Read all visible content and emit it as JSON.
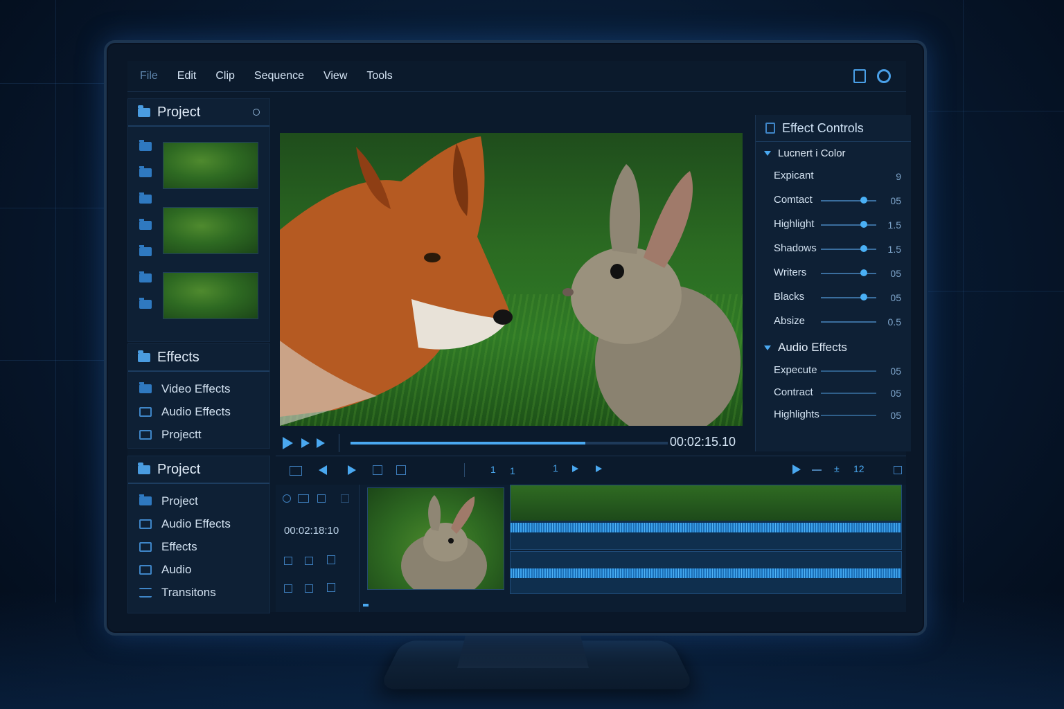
{
  "menu": {
    "items": [
      "File",
      "Edit",
      "Clip",
      "Sequence",
      "View",
      "Tools"
    ]
  },
  "project_panel": {
    "title": "Project"
  },
  "effects_panel": {
    "title": "Effects",
    "items": [
      "Video Effects",
      "Audio Effects",
      "Projectt"
    ]
  },
  "project_panel_2": {
    "title": "Project",
    "items": [
      "Project",
      "Audio Effects",
      "Effects",
      "Audio",
      "Transitons"
    ]
  },
  "viewer": {
    "timecode": "00:02:15.10",
    "progress": 0.74
  },
  "effect_controls": {
    "title": "Effect Controls",
    "color_section": "Lucnert i Color",
    "color_rows": [
      {
        "label": "Expicant",
        "value": "9",
        "level": null
      },
      {
        "label": "Comtact",
        "value": "05",
        "level": 0.78
      },
      {
        "label": "Highlight",
        "value": "1.5",
        "level": 0.78
      },
      {
        "label": "Shadows",
        "value": "1.5",
        "level": 0.78
      },
      {
        "label": "Writers",
        "value": "05",
        "level": 0.78
      },
      {
        "label": "Blacks",
        "value": "05",
        "level": 0.78
      },
      {
        "label": "Absize",
        "value": "0.5",
        "level": null
      }
    ],
    "audio_section": "Audio Effects",
    "audio_rows": [
      {
        "label": "Expecute",
        "value": "05"
      },
      {
        "label": "Contract",
        "value": "05"
      },
      {
        "label": "Highlights",
        "value": "05"
      }
    ]
  },
  "timeline": {
    "timecode": "00:02:18:10",
    "ruler_marks": [
      "1",
      "1",
      "1"
    ],
    "toolbar_right": [
      "±",
      "12"
    ]
  },
  "colors": {
    "accent": "#4aa8f0",
    "background": "#0b1a2c"
  }
}
